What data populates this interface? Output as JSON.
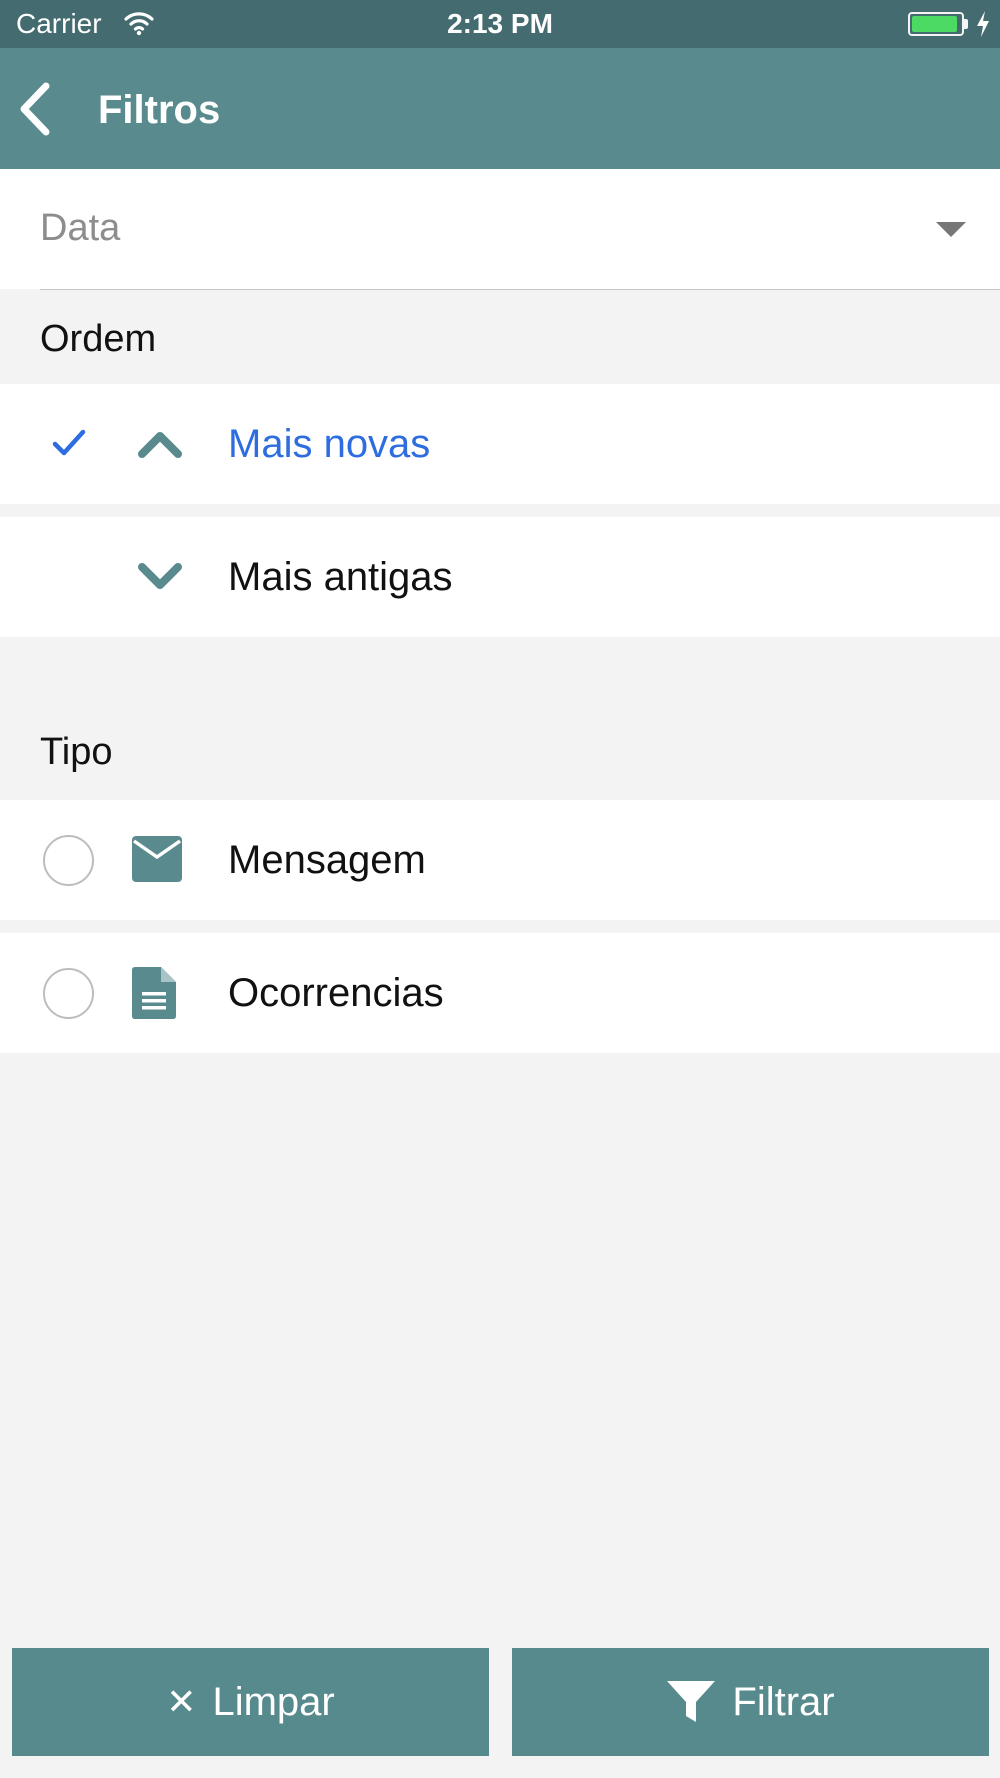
{
  "status_bar": {
    "carrier": "Carrier",
    "time": "2:13 PM",
    "battery_level": 0.93,
    "icons": [
      "wifi-icon",
      "battery-icon",
      "charging-icon"
    ]
  },
  "header": {
    "title": "Filtros",
    "back_icon": "chevron-left-icon"
  },
  "date_filter": {
    "label": "Data",
    "icon": "caret-down-icon"
  },
  "order_section": {
    "title": "Ordem",
    "options": [
      {
        "label": "Mais novas",
        "selected": true,
        "icon": "chevron-up-icon"
      },
      {
        "label": "Mais antigas",
        "selected": false,
        "icon": "chevron-down-icon"
      }
    ]
  },
  "type_section": {
    "title": "Tipo",
    "options": [
      {
        "label": "Mensagem",
        "checked": false,
        "icon": "envelope-icon"
      },
      {
        "label": "Ocorrencias",
        "checked": false,
        "icon": "document-icon"
      }
    ]
  },
  "footer": {
    "clear_label": "Limpar",
    "clear_icon": "close-icon",
    "filter_label": "Filtrar",
    "filter_icon": "funnel-icon"
  },
  "colors": {
    "status_bar_bg": "#446b70",
    "nav_bar_bg": "#598a8d",
    "accent": "#578a8c",
    "selected_text": "#2d6de0",
    "page_bg": "#f3f3f3"
  }
}
